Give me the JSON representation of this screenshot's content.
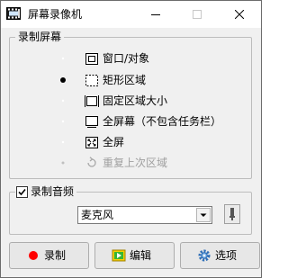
{
  "window": {
    "title": "屏幕录像机"
  },
  "screen_group": {
    "label": "录制屏幕",
    "options": [
      {
        "label": "窗口/对象",
        "selected": false,
        "enabled": true,
        "icon": "window-object-icon"
      },
      {
        "label": "矩形区域",
        "selected": true,
        "enabled": true,
        "icon": "rect-region-icon"
      },
      {
        "label": "固定区域大小",
        "selected": false,
        "enabled": true,
        "icon": "fixed-region-icon"
      },
      {
        "label": "全屏幕（不包含任务栏）",
        "selected": false,
        "enabled": true,
        "icon": "monitor-icon"
      },
      {
        "label": "全屏",
        "selected": false,
        "enabled": true,
        "icon": "fullscreen-icon"
      },
      {
        "label": "重复上次区域",
        "selected": false,
        "enabled": false,
        "icon": "repeat-icon"
      }
    ]
  },
  "audio_group": {
    "label": "录制音频",
    "checked": true,
    "device": "麦克风"
  },
  "buttons": {
    "record": "录制",
    "edit": "编辑",
    "options": "选项"
  }
}
